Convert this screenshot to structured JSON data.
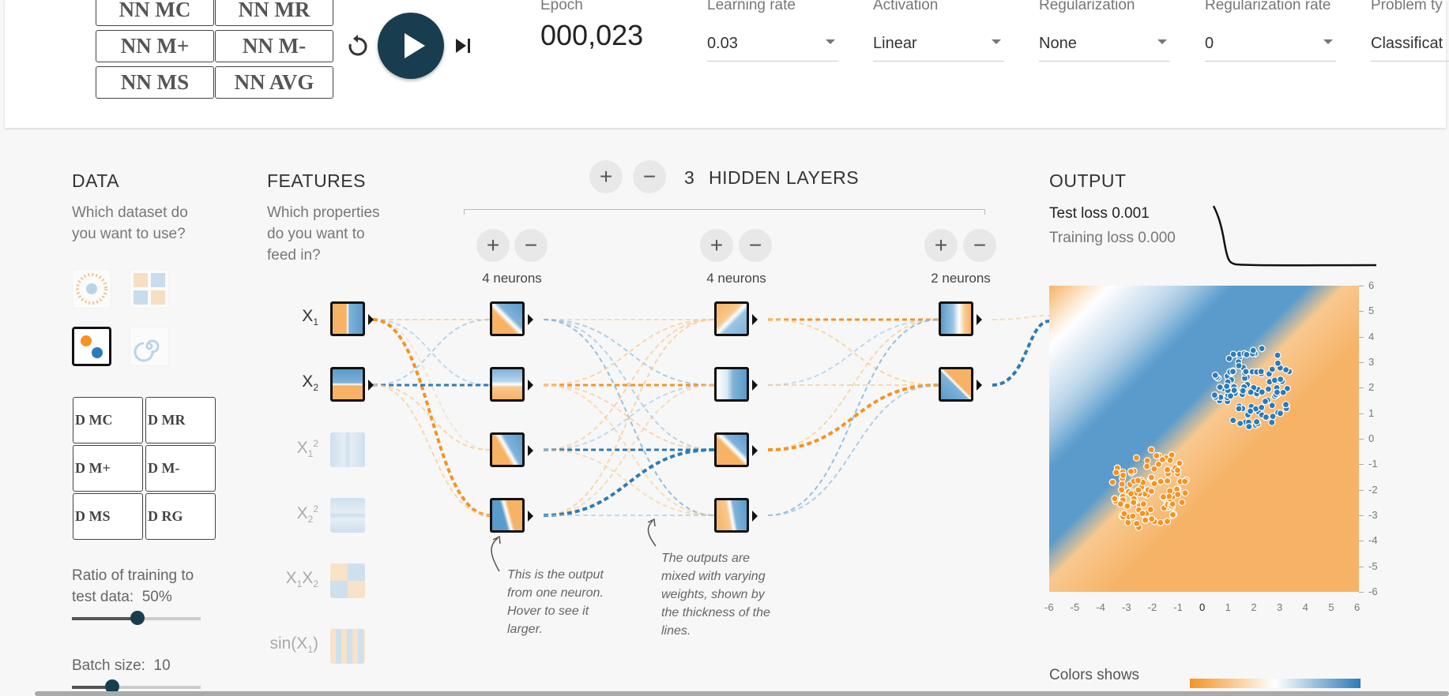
{
  "toolbar": {
    "nn_buttons": [
      "NN MC",
      "NN MR",
      "NN M+",
      "NN M-",
      "NN MS",
      "NN AVG"
    ],
    "epoch_label": "Epoch",
    "epoch_value": "000,023",
    "controls": [
      {
        "label": "Learning rate",
        "value": "0.03"
      },
      {
        "label": "Activation",
        "value": "Linear"
      },
      {
        "label": "Regularization",
        "value": "None"
      },
      {
        "label": "Regularization rate",
        "value": "0"
      },
      {
        "label": "Problem ty",
        "value": "Classificat"
      }
    ]
  },
  "data_section": {
    "title": "DATA",
    "subtitle": "Which dataset do you want to use?",
    "buttons": [
      "D MC",
      "D MR",
      "D M+",
      "D M-",
      "D MS",
      "D RG"
    ],
    "ratio_label": "Ratio of training to test data:",
    "ratio_value": "50%",
    "ratio_fraction": 0.5,
    "batch_label": "Batch size:",
    "batch_value": "10"
  },
  "features_section": {
    "title": "FEATURES",
    "subtitle": "Which properties do you want to feed in?",
    "features": [
      {
        "base": "X",
        "sub": "1",
        "sup": "",
        "active": true
      },
      {
        "base": "X",
        "sub": "2",
        "sup": "",
        "active": true
      },
      {
        "base": "X",
        "sub": "1",
        "sup": "2",
        "active": false
      },
      {
        "base": "X",
        "sub": "2",
        "sup": "2",
        "active": false
      },
      {
        "base": "X",
        "sub": "1",
        "sup": "",
        "extra": "X2",
        "active": false
      },
      {
        "base": "sin(X",
        "sub": "1",
        "sup": "",
        "close": ")",
        "active": false
      }
    ]
  },
  "network": {
    "add_symbol": "+",
    "remove_symbol": "−",
    "layer_count": "3",
    "hidden_layers_label": "HIDDEN LAYERS",
    "layers": [
      {
        "neurons_label": "4 neurons"
      },
      {
        "neurons_label": "4 neurons"
      },
      {
        "neurons_label": "2 neurons"
      }
    ],
    "annotation_neuron": "This is the output from one neuron. Hover to see it larger.",
    "annotation_weights": "The outputs are mixed with varying weights, shown by the thickness of the lines."
  },
  "output_section": {
    "title": "OUTPUT",
    "test_loss": "Test loss 0.001",
    "training_loss": "Training loss 0.000",
    "x_ticks": [
      "-6",
      "-5",
      "-4",
      "-3",
      "-2",
      "-1",
      "0",
      "1",
      "2",
      "3",
      "4",
      "5",
      "6"
    ],
    "y_ticks": [
      "6",
      "5",
      "4",
      "3",
      "2",
      "1",
      "0",
      "-1",
      "-2",
      "-3",
      "-4",
      "-5",
      "-6"
    ],
    "colors_label": "Colors shows",
    "colors": {
      "positive": "#2c7bb6",
      "negative": "#f59322"
    }
  }
}
